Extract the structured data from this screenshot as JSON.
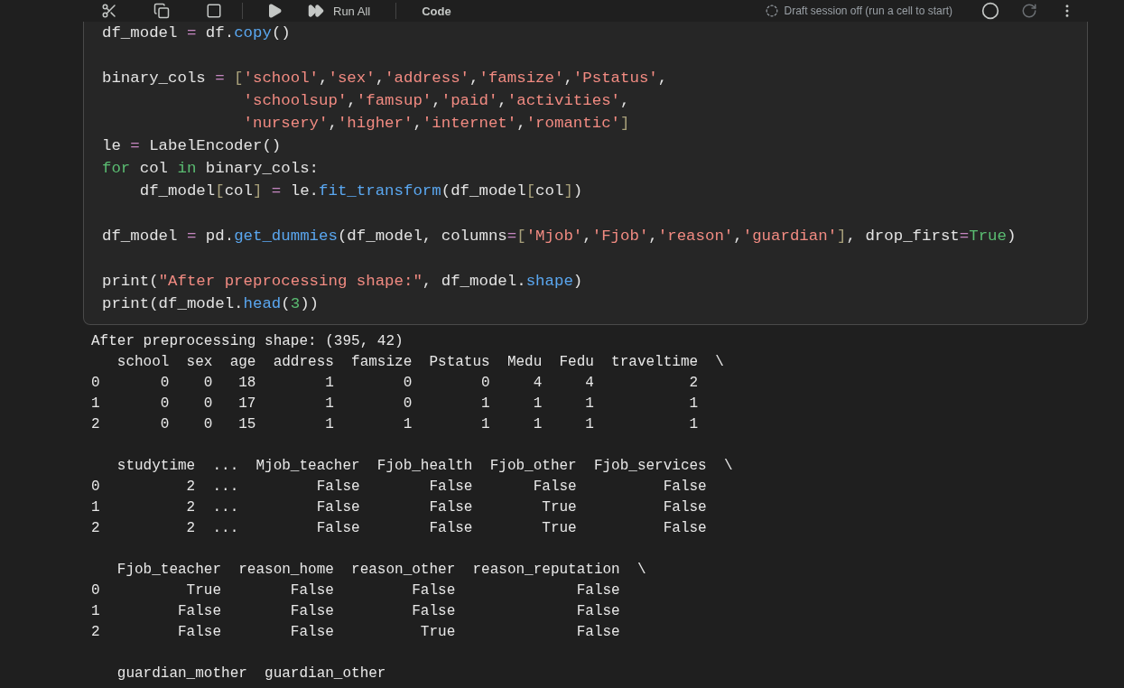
{
  "toolbar": {
    "run_all": "Run All",
    "cell_type": "Code",
    "session_status": "Draft session off (run a cell to start)"
  },
  "code_blocks": [
    [
      [
        {
          "text": "df_model ",
          "kind": "plain"
        },
        {
          "text": "=",
          "kind": "op"
        },
        {
          "text": " df.",
          "kind": "plain"
        },
        {
          "text": "copy",
          "kind": "func"
        },
        {
          "text": "()",
          "kind": "plain"
        }
      ]
    ],
    [
      [
        {
          "text": "binary_cols ",
          "kind": "plain"
        },
        {
          "text": "= ",
          "kind": "op"
        },
        {
          "text": "[",
          "kind": "bracket"
        },
        {
          "text": "'school'",
          "kind": "string"
        },
        {
          "text": ",",
          "kind": "plain"
        },
        {
          "text": "'sex'",
          "kind": "string"
        },
        {
          "text": ",",
          "kind": "plain"
        },
        {
          "text": "'address'",
          "kind": "string"
        },
        {
          "text": ",",
          "kind": "plain"
        },
        {
          "text": "'famsize'",
          "kind": "string"
        },
        {
          "text": ",",
          "kind": "plain"
        },
        {
          "text": "'Pstatus'",
          "kind": "string"
        },
        {
          "text": ",",
          "kind": "plain"
        }
      ],
      [
        {
          "text": "               'schoolsup'",
          "kind": "string"
        },
        {
          "text": ",",
          "kind": "plain"
        },
        {
          "text": "'famsup'",
          "kind": "string"
        },
        {
          "text": ",",
          "kind": "plain"
        },
        {
          "text": "'paid'",
          "kind": "string"
        },
        {
          "text": ",",
          "kind": "plain"
        },
        {
          "text": "'activities'",
          "kind": "string"
        },
        {
          "text": ",",
          "kind": "plain"
        }
      ],
      [
        {
          "text": "               'nursery'",
          "kind": "string"
        },
        {
          "text": ",",
          "kind": "plain"
        },
        {
          "text": "'higher'",
          "kind": "string"
        },
        {
          "text": ",",
          "kind": "plain"
        },
        {
          "text": "'internet'",
          "kind": "string"
        },
        {
          "text": ",",
          "kind": "plain"
        },
        {
          "text": "'romantic'",
          "kind": "string"
        },
        {
          "text": "]",
          "kind": "bracket"
        }
      ],
      [
        {
          "text": "le ",
          "kind": "plain"
        },
        {
          "text": "=",
          "kind": "op"
        },
        {
          "text": " LabelEncoder()",
          "kind": "plain"
        }
      ],
      [
        {
          "text": "for",
          "kind": "keyword"
        },
        {
          "text": " col ",
          "kind": "plain"
        },
        {
          "text": "in",
          "kind": "keyword"
        },
        {
          "text": " binary_cols:",
          "kind": "plain"
        }
      ],
      [
        {
          "text": "    df_model",
          "kind": "plain"
        },
        {
          "text": "[",
          "kind": "bracket"
        },
        {
          "text": "col",
          "kind": "plain"
        },
        {
          "text": "] ",
          "kind": "bracket"
        },
        {
          "text": "=",
          "kind": "op"
        },
        {
          "text": " le.",
          "kind": "plain"
        },
        {
          "text": "fit_transform",
          "kind": "func"
        },
        {
          "text": "(df_model",
          "kind": "plain"
        },
        {
          "text": "[",
          "kind": "bracket"
        },
        {
          "text": "col",
          "kind": "plain"
        },
        {
          "text": "]",
          "kind": "bracket"
        },
        {
          "text": ")",
          "kind": "plain"
        }
      ]
    ],
    [
      [
        {
          "text": "df_model ",
          "kind": "plain"
        },
        {
          "text": "=",
          "kind": "op"
        },
        {
          "text": " pd.",
          "kind": "plain"
        },
        {
          "text": "get_dummies",
          "kind": "func"
        },
        {
          "text": "(df_model, columns",
          "kind": "plain"
        },
        {
          "text": "=",
          "kind": "op"
        },
        {
          "text": "[",
          "kind": "bracket"
        },
        {
          "text": "'Mjob'",
          "kind": "string"
        },
        {
          "text": ",",
          "kind": "plain"
        },
        {
          "text": "'Fjob'",
          "kind": "string"
        },
        {
          "text": ",",
          "kind": "plain"
        },
        {
          "text": "'reason'",
          "kind": "string"
        },
        {
          "text": ",",
          "kind": "plain"
        },
        {
          "text": "'guardian'",
          "kind": "string"
        },
        {
          "text": "]",
          "kind": "bracket"
        },
        {
          "text": ", drop_first",
          "kind": "plain"
        },
        {
          "text": "=",
          "kind": "op"
        },
        {
          "text": "True",
          "kind": "constant"
        },
        {
          "text": ")",
          "kind": "plain"
        }
      ]
    ],
    [
      [
        {
          "text": "print(",
          "kind": "plain"
        },
        {
          "text": "\"After preprocessing shape:\"",
          "kind": "string"
        },
        {
          "text": ", df_model.",
          "kind": "plain"
        },
        {
          "text": "shape",
          "kind": "func"
        },
        {
          "text": ")",
          "kind": "plain"
        }
      ],
      [
        {
          "text": "print(df_model.",
          "kind": "plain"
        },
        {
          "text": "head",
          "kind": "func"
        },
        {
          "text": "(",
          "kind": "plain"
        },
        {
          "text": "3",
          "kind": "constant"
        },
        {
          "text": "))",
          "kind": "plain"
        }
      ]
    ]
  ],
  "output_blocks": [
    [
      "After preprocessing shape: (395, 42)",
      "   school  sex  age  address  famsize  Pstatus  Medu  Fedu  traveltime  \\",
      "0       0    0   18        1        0        0     4     4           2",
      "1       0    0   17        1        0        1     1     1           1",
      "2       0    0   15        1        1        1     1     1           1"
    ],
    [
      "   studytime  ...  Mjob_teacher  Fjob_health  Fjob_other  Fjob_services  \\",
      "0          2  ...         False        False       False          False",
      "1          2  ...         False        False        True          False",
      "2          2  ...         False        False        True          False"
    ],
    [
      "   Fjob_teacher  reason_home  reason_other  reason_reputation  \\",
      "0          True        False         False              False",
      "1         False        False         False              False",
      "2         False        False          True              False"
    ],
    [
      "   guardian_mother  guardian_other"
    ]
  ]
}
